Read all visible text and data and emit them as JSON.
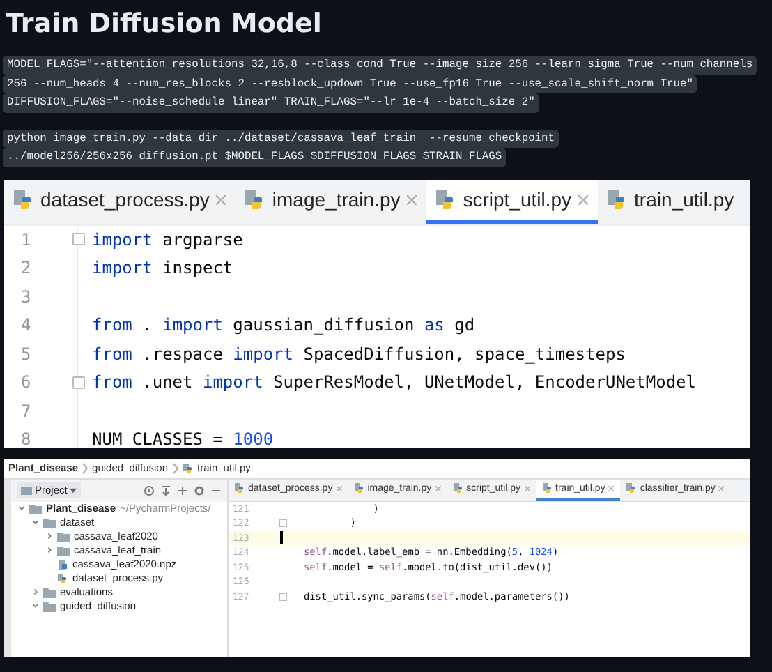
{
  "title": "Train Diffusion Model",
  "command_blocks": [
    {
      "lines": [
        "MODEL_FLAGS=\"--attention_resolutions 32,16,8 --class_cond True --image_size 256 --learn_sigma True --num_channels",
        "256 --num_heads 4 --num_res_blocks 2 --resblock_updown True --use_fp16 True --use_scale_shift_norm True\"",
        "DIFFUSION_FLAGS=\"--noise_schedule linear\" TRAIN_FLAGS=\"--lr 1e-4 --batch_size 2\""
      ]
    },
    {
      "lines": [
        "python image_train.py --data_dir ../dataset/cassava_leaf_train  --resume_checkpoint",
        "../model256/256x256_diffusion.pt $MODEL_FLAGS $DIFFUSION_FLAGS $TRAIN_FLAGS"
      ]
    }
  ],
  "editor_screenshot": {
    "tabs": [
      {
        "label": "dataset_process.py",
        "selected": false,
        "closable": true
      },
      {
        "label": "image_train.py",
        "selected": false,
        "closable": true
      },
      {
        "label": "script_util.py",
        "selected": true,
        "closable": true
      },
      {
        "label": "train_util.py",
        "selected": false,
        "closable": false
      }
    ],
    "lines": [
      {
        "number": "1",
        "fold": true,
        "tokens": [
          {
            "kind": "keyword",
            "text": "import"
          },
          {
            "kind": "plain",
            "text": " argparse"
          }
        ]
      },
      {
        "number": "2",
        "fold": false,
        "tokens": [
          {
            "kind": "keyword",
            "text": "import"
          },
          {
            "kind": "plain",
            "text": " inspect"
          }
        ]
      },
      {
        "number": "3",
        "fold": false
      },
      {
        "number": "4",
        "fold": false,
        "tokens": [
          {
            "kind": "keyword",
            "text": "from"
          },
          {
            "kind": "plain",
            "text": " . "
          },
          {
            "kind": "keyword",
            "text": "import"
          },
          {
            "kind": "plain",
            "text": " gaussian_diffusion "
          },
          {
            "kind": "keyword",
            "text": "as"
          },
          {
            "kind": "plain",
            "text": " gd"
          }
        ]
      },
      {
        "number": "5",
        "fold": false,
        "tokens": [
          {
            "kind": "keyword",
            "text": "from"
          },
          {
            "kind": "plain",
            "text": " .respace "
          },
          {
            "kind": "keyword",
            "text": "import"
          },
          {
            "kind": "plain",
            "text": " SpacedDiffusion, space_timesteps"
          }
        ]
      },
      {
        "number": "6",
        "fold": true,
        "tokens": [
          {
            "kind": "keyword",
            "text": "from"
          },
          {
            "kind": "plain",
            "text": " .unet "
          },
          {
            "kind": "keyword",
            "text": "import"
          },
          {
            "kind": "plain",
            "text": " SuperResModel, UNetModel, EncoderUNetModel"
          }
        ]
      },
      {
        "number": "7",
        "fold": false
      },
      {
        "number": "8",
        "fold": false,
        "tokens": [
          {
            "kind": "plain",
            "text": "NUM_CLASSES = "
          },
          {
            "kind": "number",
            "text": "1000"
          }
        ]
      }
    ]
  },
  "ide_screenshot": {
    "breadcrumbs": [
      "Plant_disease",
      "guided_diffusion",
      "train_util.py"
    ],
    "project_panel": {
      "title": "Project",
      "tree": [
        {
          "label": "Plant_disease",
          "note": "~/PycharmProjects/",
          "kind": "folder",
          "expanded": true,
          "children": [
            {
              "label": "dataset",
              "kind": "folder",
              "expanded": true,
              "children": [
                {
                  "label": "cassava_leaf2020",
                  "kind": "folder",
                  "expanded": false
                },
                {
                  "label": "cassava_leaf_train",
                  "kind": "folder",
                  "expanded": false
                },
                {
                  "label": "cassava_leaf2020.npz",
                  "kind": "file"
                },
                {
                  "label": "dataset_process.py",
                  "kind": "python"
                }
              ]
            },
            {
              "label": "evaluations",
              "kind": "folder",
              "expanded": false
            },
            {
              "label": "guided_diffusion",
              "kind": "folder",
              "expanded": true
            }
          ]
        }
      ]
    },
    "tabs": [
      {
        "label": "dataset_process.py",
        "selected": false
      },
      {
        "label": "image_train.py",
        "selected": false
      },
      {
        "label": "script_util.py",
        "selected": false
      },
      {
        "label": "train_util.py",
        "selected": true
      },
      {
        "label": "classifier_train.py",
        "selected": false
      }
    ],
    "lines": [
      {
        "number": "121",
        "fold": false,
        "current": false,
        "tokens": [
          {
            "kind": "plain",
            "text": "            )"
          }
        ]
      },
      {
        "number": "122",
        "fold": true,
        "current": false,
        "tokens": [
          {
            "kind": "plain",
            "text": "        )"
          }
        ]
      },
      {
        "number": "123",
        "fold": false,
        "current": true
      },
      {
        "number": "124",
        "fold": false,
        "current": false,
        "tokens": [
          {
            "kind": "self",
            "text": "self"
          },
          {
            "kind": "plain",
            "text": ".model.label_emb = nn.Embedding("
          },
          {
            "kind": "number",
            "text": "5"
          },
          {
            "kind": "plain",
            "text": ", "
          },
          {
            "kind": "number",
            "text": "1024"
          },
          {
            "kind": "plain",
            "text": ")"
          }
        ]
      },
      {
        "number": "125",
        "fold": false,
        "current": false,
        "tokens": [
          {
            "kind": "self",
            "text": "self"
          },
          {
            "kind": "plain",
            "text": ".model = "
          },
          {
            "kind": "self",
            "text": "self"
          },
          {
            "kind": "plain",
            "text": ".model.to(dist_util.dev())"
          }
        ]
      },
      {
        "number": "126",
        "fold": false,
        "current": false
      },
      {
        "number": "127",
        "fold": true,
        "current": false,
        "tokens": [
          {
            "kind": "plain",
            "text": "dist_util.sync_params("
          },
          {
            "kind": "self",
            "text": "self"
          },
          {
            "kind": "plain",
            "text": ".model.parameters())"
          }
        ]
      }
    ]
  }
}
